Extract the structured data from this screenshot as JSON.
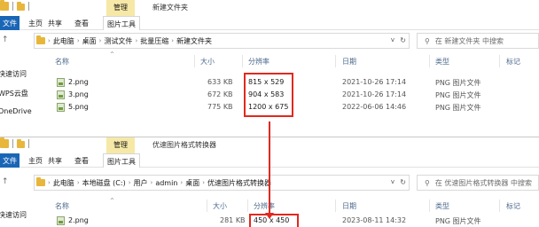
{
  "window1": {
    "title": "新建文件夹",
    "context_tab": "管理",
    "ribbon": {
      "file": "文件",
      "home": "主页",
      "share": "共享",
      "view": "查看",
      "tool": "图片工具"
    },
    "breadcrumb": [
      "此电脑",
      "桌面",
      "测试文件",
      "批量压缩",
      "新建文件夹"
    ],
    "search_placeholder": "在 新建文件夹 中搜索",
    "nav": [
      "快速访问",
      "WPS云盘",
      "OneDrive"
    ],
    "columns": {
      "name": "名称",
      "size": "大小",
      "resolution": "分辨率",
      "date": "日期",
      "type": "类型",
      "tags": "标记"
    },
    "files": [
      {
        "name": "2.png",
        "size": "633 KB",
        "resolution": "815 x 529",
        "date": "2021-10-26 17:14",
        "type": "PNG 图片文件"
      },
      {
        "name": "3.png",
        "size": "672 KB",
        "resolution": "904 x 583",
        "date": "2021-10-26 17:14",
        "type": "PNG 图片文件"
      },
      {
        "name": "5.png",
        "size": "775 KB",
        "resolution": "1200 x 675",
        "date": "2022-06-06 14:46",
        "type": "PNG 图片文件"
      }
    ]
  },
  "window2": {
    "title": "优速图片格式转换器",
    "context_tab": "管理",
    "ribbon": {
      "file": "文件",
      "home": "主页",
      "share": "共享",
      "view": "查看",
      "tool": "图片工具"
    },
    "breadcrumb": [
      "此电脑",
      "本地磁盘 (C:)",
      "用户",
      "admin",
      "桌面",
      "优速图片格式转换器"
    ],
    "search_placeholder": "在 优速图片格式转换器 中搜索",
    "nav": [
      "快速访问"
    ],
    "columns": {
      "name": "名称",
      "size": "大小",
      "resolution": "分辨率",
      "date": "日期",
      "type": "类型",
      "tags": "标记"
    },
    "files": [
      {
        "name": "2.png",
        "size": "281 KB",
        "resolution": "450 x 450",
        "date": "2023-08-11 14:32",
        "type": "PNG 图片文件"
      }
    ]
  },
  "colors": {
    "highlight": "#e0291f",
    "context_tab": "#f6e8a6",
    "file_tab": "#1a66b6",
    "column_header": "#4d6a8c"
  },
  "icons": [
    "folder-icon",
    "png-file-icon",
    "search-icon",
    "refresh-icon",
    "back-arrow-icon",
    "forward-arrow-icon",
    "up-arrow-icon"
  ]
}
